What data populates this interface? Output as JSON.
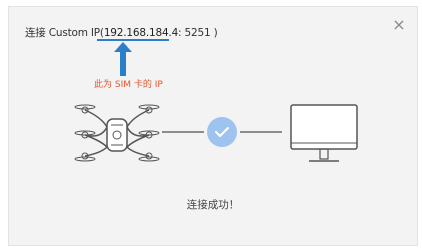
{
  "dialog": {
    "title_prefix": "连接 Custom IP(",
    "title_ip": "192.168.184.4",
    "title_port": ": 5251 )",
    "close_symbol": "×",
    "status_text": "连接成功！"
  },
  "annotation": {
    "text": "此为 SIM 卡的 IP",
    "color": "#e4572e",
    "line_color": "#2b7fc8"
  },
  "icons": {
    "drone": "drone-icon",
    "check": "check-icon",
    "monitor": "monitor-icon",
    "close": "close-icon"
  },
  "colors": {
    "dialog_bg": "#f3f3f3",
    "check_circle": "#9fc3ef",
    "check_mark": "#ffffff",
    "line": "#6a6a6a"
  }
}
